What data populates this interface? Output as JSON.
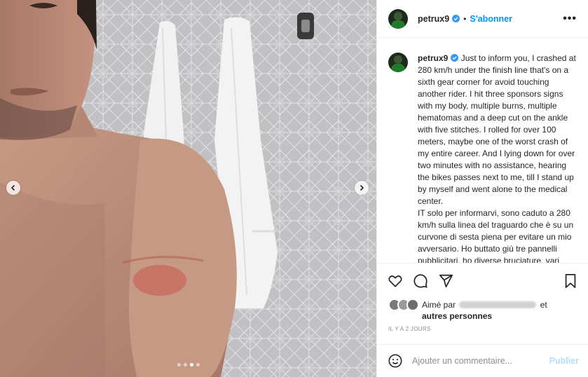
{
  "post": {
    "username": "petrux9",
    "follow_label": "S'abonner",
    "more_label": "•••",
    "caption_en": "Just to inform you, I crashed at 280 km/h under the finish line that's on a sixth gear corner for avoid touching another rider. I hit three sponsors signs with my body, multiple burns, multiple hematomas and a deep cut on the ankle with five stitches. I rolled for over 100 meters, maybe one of the worst crash of my entire career. And I lying down for over two minutes with no assistance, hearing the bikes passes next to me, till I stand up by myself and went alone to the medical center.",
    "caption_it": "IT solo per informarvi, sono caduto a 280 km/h sulla linea del traguardo che è su un curvone di sesta piena per evitare un mio avversario. Ho buttato giù tre pannelli pubblicitari, ho diverse bruciature, vari ematomi e un taglio profondo"
  },
  "likes": {
    "prefix": "Aimé par",
    "suffix": "et",
    "others": "autres personnes"
  },
  "timestamp": "IL Y A 2 JOURS",
  "comment": {
    "placeholder": "Ajouter un commentaire...",
    "publish_label": "Publier"
  },
  "carousel": {
    "slide_count": 4,
    "active_slide": 3
  },
  "colors": {
    "accent": "#0095f6",
    "publish_disabled": "#b2dffc",
    "verified": "#3897f0"
  }
}
